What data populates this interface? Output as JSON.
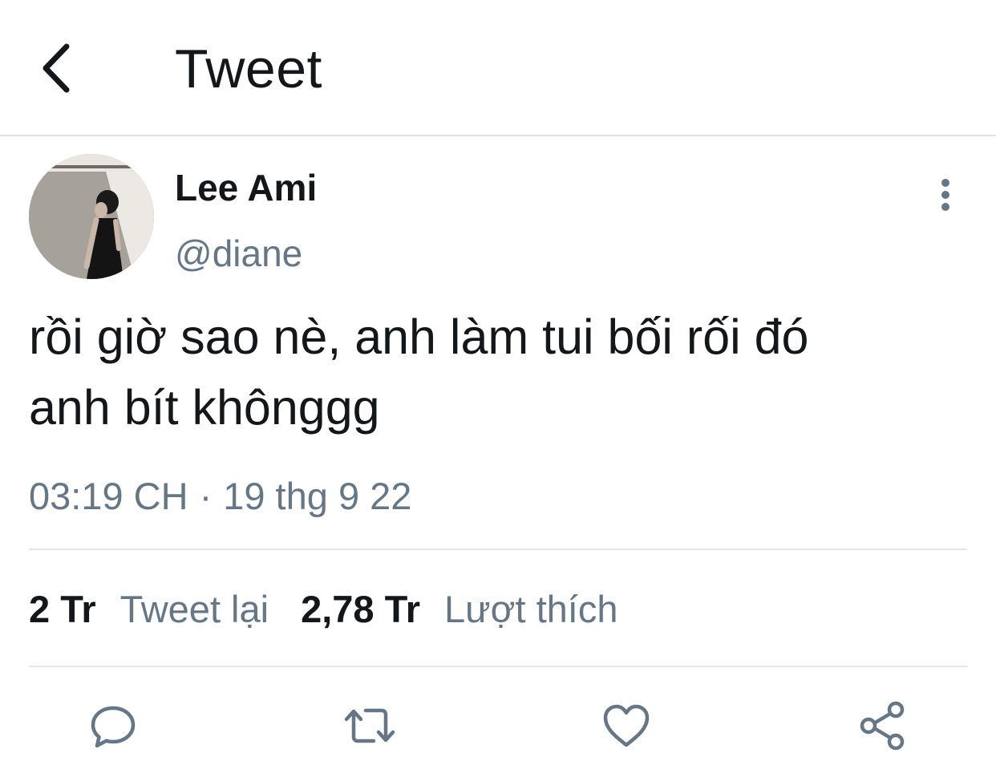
{
  "header": {
    "title": "Tweet",
    "back_icon": "chevron-left-icon"
  },
  "author": {
    "display_name": "Lee Ami",
    "handle": "@diane",
    "avatar": "profile-photo"
  },
  "tweet": {
    "text": "rồi giờ sao nè, anh làm tui bối rối đó\nanh bít khônggg",
    "time": "03:19 CH",
    "separator": "·",
    "date": "19 thg 9 22"
  },
  "stats": {
    "retweet_count": "2 Tr",
    "retweet_label": "Tweet lại",
    "like_count": "2,78 Tr",
    "like_label": "Lượt thích"
  },
  "actions": [
    {
      "name": "reply",
      "icon": "comment-icon"
    },
    {
      "name": "retweet",
      "icon": "retweet-icon"
    },
    {
      "name": "like",
      "icon": "heart-icon"
    },
    {
      "name": "share",
      "icon": "share-icon"
    }
  ],
  "colors": {
    "text_primary": "#14171a",
    "text_secondary": "#657786",
    "icon": "#657786",
    "divider": "#e3e6e8"
  }
}
